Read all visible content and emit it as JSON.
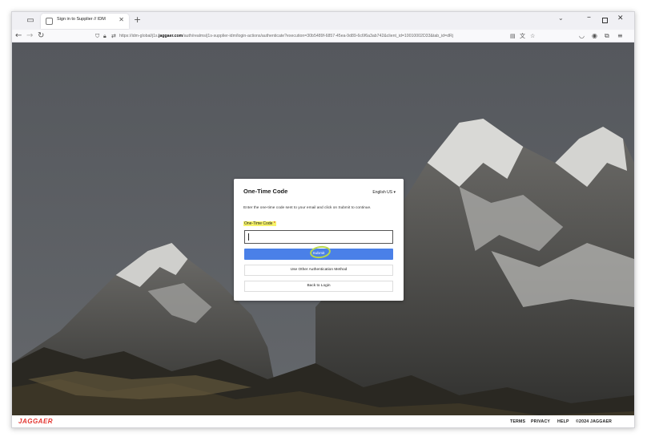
{
  "browser": {
    "tab_title": "Sign in to Supplier // IDM",
    "url_prefix": "https://idm-global/j1s.",
    "url_domain": "jaggaer.com",
    "url_rest": "/auth/realms/j1s-supplier-idm/login-actions/authenticate?execution=30b5489f-6857-45ea-9d89-6c6f6a3ab742&client_id=10010002D33&tab_id=dRj"
  },
  "modal": {
    "title": "One-Time Code",
    "language": "English US",
    "instruction": "Enter the one-time code sent to your email and click on Submit to continue.",
    "field_label": "One-Time Code",
    "required_mark": "*",
    "input_value": "",
    "submit_label": "Submit",
    "alt_method_label": "Use Other Authentication Method",
    "back_label": "Back to Login"
  },
  "footer": {
    "logo_text": "JAGGAER",
    "links": [
      "TERMS",
      "PRIVACY",
      "HELP"
    ],
    "copyright": "©2024 JAGGAER"
  },
  "colors": {
    "primary_button": "#4a80e8",
    "logo": "#e3342f",
    "label_highlight": "#f6f36a",
    "annotation_ring": "#b8d84a"
  }
}
